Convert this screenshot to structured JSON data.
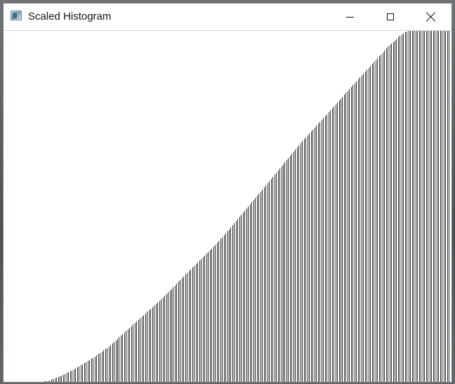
{
  "window": {
    "title": "Scaled Histogram",
    "icons": {
      "app": "window-app-icon",
      "minimize": "minimize-icon",
      "maximize": "maximize-icon",
      "close": "close-icon"
    }
  },
  "colors": {
    "bar": "#2b2b2b",
    "background": "#ffffff"
  },
  "chart_data": {
    "type": "bar",
    "title": "",
    "xlabel": "",
    "ylabel": "",
    "x_count": 256,
    "ylim": [
      0,
      1
    ],
    "grid": false,
    "legend": "none",
    "values_description_points": [
      [
        0,
        0.0
      ],
      [
        20,
        0.0
      ],
      [
        25,
        0.002
      ],
      [
        32,
        0.015
      ],
      [
        40,
        0.035
      ],
      [
        50,
        0.065
      ],
      [
        60,
        0.1
      ],
      [
        70,
        0.145
      ],
      [
        80,
        0.19
      ],
      [
        90,
        0.235
      ],
      [
        100,
        0.285
      ],
      [
        110,
        0.335
      ],
      [
        120,
        0.385
      ],
      [
        130,
        0.44
      ],
      [
        140,
        0.5
      ],
      [
        150,
        0.56
      ],
      [
        160,
        0.62
      ],
      [
        170,
        0.68
      ],
      [
        180,
        0.735
      ],
      [
        190,
        0.79
      ],
      [
        200,
        0.845
      ],
      [
        210,
        0.9
      ],
      [
        220,
        0.955
      ],
      [
        228,
        0.99
      ],
      [
        232,
        1.0
      ],
      [
        255,
        1.0
      ]
    ]
  }
}
